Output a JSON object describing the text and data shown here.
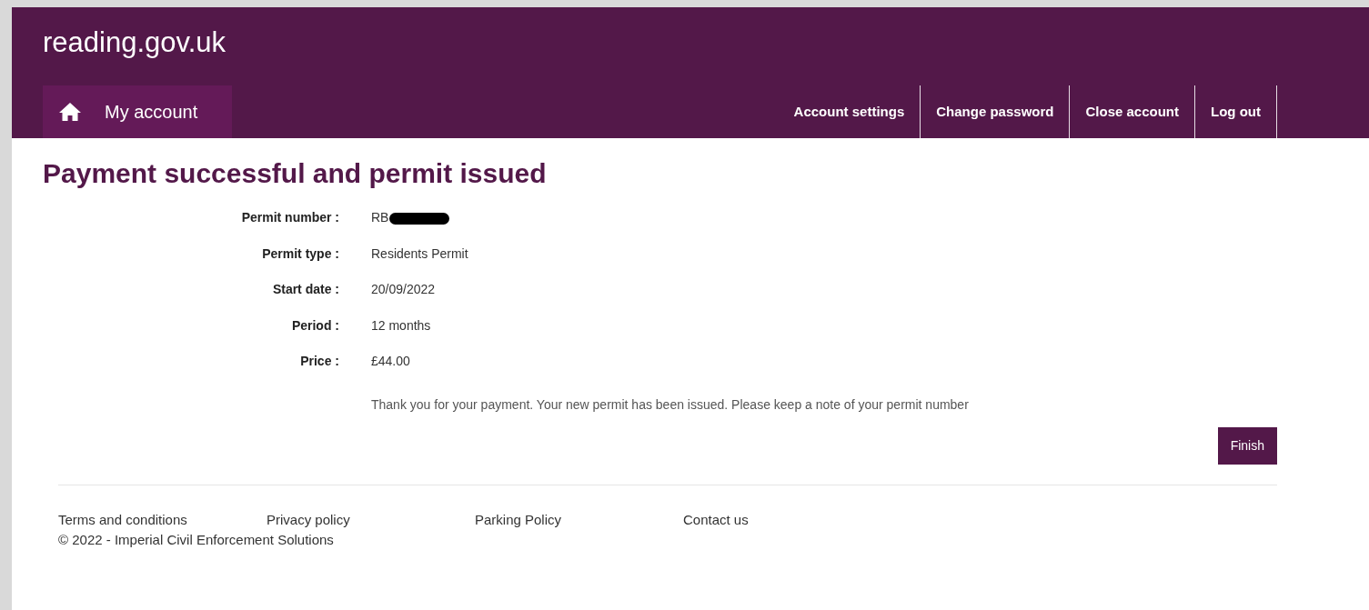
{
  "header": {
    "site_title": "reading.gov.uk"
  },
  "nav": {
    "home": {
      "label": "My account",
      "selected": true
    },
    "links": [
      {
        "label": "Account settings"
      },
      {
        "label": "Change password"
      },
      {
        "label": "Close account"
      },
      {
        "label": "Log out"
      }
    ]
  },
  "page": {
    "heading": "Payment successful and permit issued",
    "details": [
      {
        "label": "Permit number :",
        "value": "RB",
        "redacted": true
      },
      {
        "label": "Permit type :",
        "value": "Residents Permit",
        "redacted": false
      },
      {
        "label": "Start date :",
        "value": "20/09/2022",
        "redacted": false
      },
      {
        "label": "Period :",
        "value": "12 months",
        "redacted": false
      },
      {
        "label": "Price :",
        "value": "£44.00",
        "redacted": false
      }
    ],
    "message": "Thank you for your payment. Your new permit has been issued. Please keep a note of your permit number",
    "button": "Finish"
  },
  "footer": {
    "links": [
      "Terms and conditions",
      "Privacy policy",
      "Parking Policy",
      "Contact us"
    ],
    "copyright": "© 2022 - Imperial Civil Enforcement Solutions"
  }
}
